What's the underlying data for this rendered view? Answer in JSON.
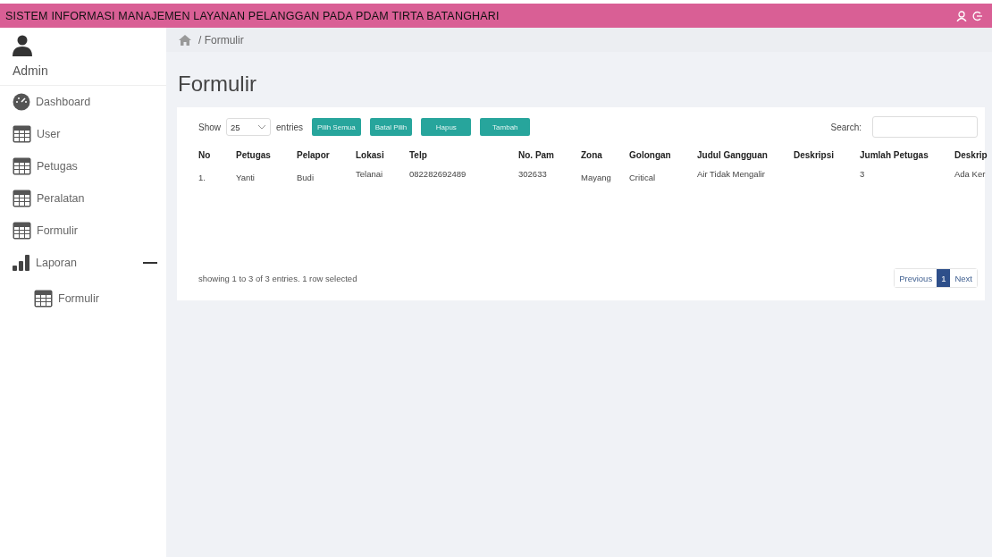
{
  "header": {
    "title": "SISTEM INFORMASI MANAJEMEN LAYANAN PELANGGAN PADA PDAM TIRTA BATANGHARI"
  },
  "sidebar": {
    "user": "Admin",
    "items": [
      {
        "label": "Dashboard",
        "kind": "dashboard",
        "expanded": false
      },
      {
        "label": "User",
        "kind": "table",
        "expanded": false
      },
      {
        "label": "Petugas",
        "kind": "table",
        "expanded": false
      },
      {
        "label": "Peralatan",
        "kind": "table",
        "expanded": false
      },
      {
        "label": "Formulir",
        "kind": "table",
        "expanded": false
      },
      {
        "label": "Laporan",
        "kind": "chart",
        "expanded": true,
        "children": [
          {
            "label": "Formulir",
            "kind": "table"
          }
        ]
      }
    ]
  },
  "breadcrumb": "/ Formulir",
  "page_title": "Formulir",
  "toolbar": {
    "show_label": "Show",
    "page_size": "25",
    "entries_label": "entries",
    "buttons": [
      "Pilih Semua",
      "Batal Pilih",
      "Hapus",
      "Tambah"
    ],
    "search_label": "Search:"
  },
  "table": {
    "columns": [
      "No",
      "Petugas",
      "Pelapor",
      "Lokasi",
      "Telp",
      "No. Pam",
      "Zona",
      "Golongan",
      "Judul Gangguan",
      "Deskripsi",
      "Jumlah Petugas",
      "Deskrip"
    ],
    "rows": [
      [
        "1.",
        "Yanti",
        "Budi",
        "Telanai",
        "082282692489",
        "302633",
        "Mayang",
        "Critical",
        "Air Tidak Mengalir",
        "",
        "3",
        "Ada Ker"
      ]
    ]
  },
  "footer": {
    "info": "showing 1 to 3 of  3 entries. 1 row selected",
    "previous": "Previous",
    "pages": [
      {
        "label": "1",
        "selected": true
      }
    ],
    "next": "Next"
  }
}
